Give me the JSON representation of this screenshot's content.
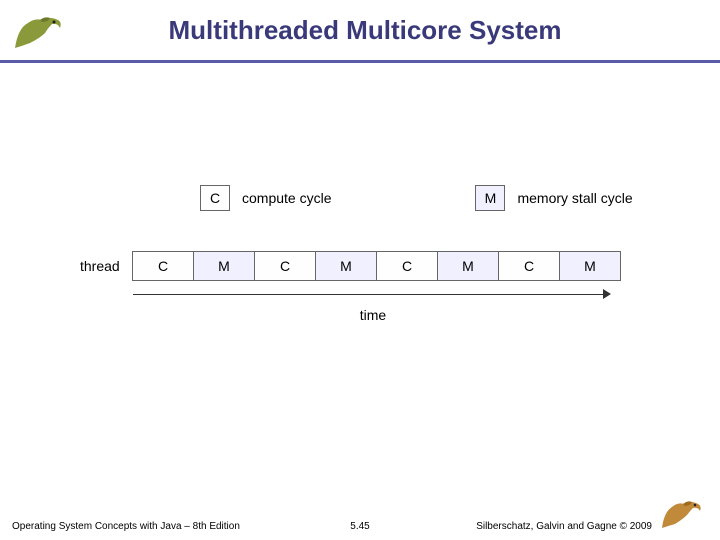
{
  "title": "Multithreaded Multicore System",
  "legend": {
    "c_symbol": "C",
    "c_label": "compute cycle",
    "m_symbol": "M",
    "m_label": "memory stall cycle"
  },
  "thread_label": "thread",
  "timeline": [
    "C",
    "M",
    "C",
    "M",
    "C",
    "M",
    "C",
    "M"
  ],
  "time_label": "time",
  "footer": {
    "left": "Operating System Concepts with Java – 8th Edition",
    "center": "5.45",
    "right": "Silberschatz, Galvin and Gagne © 2009"
  }
}
